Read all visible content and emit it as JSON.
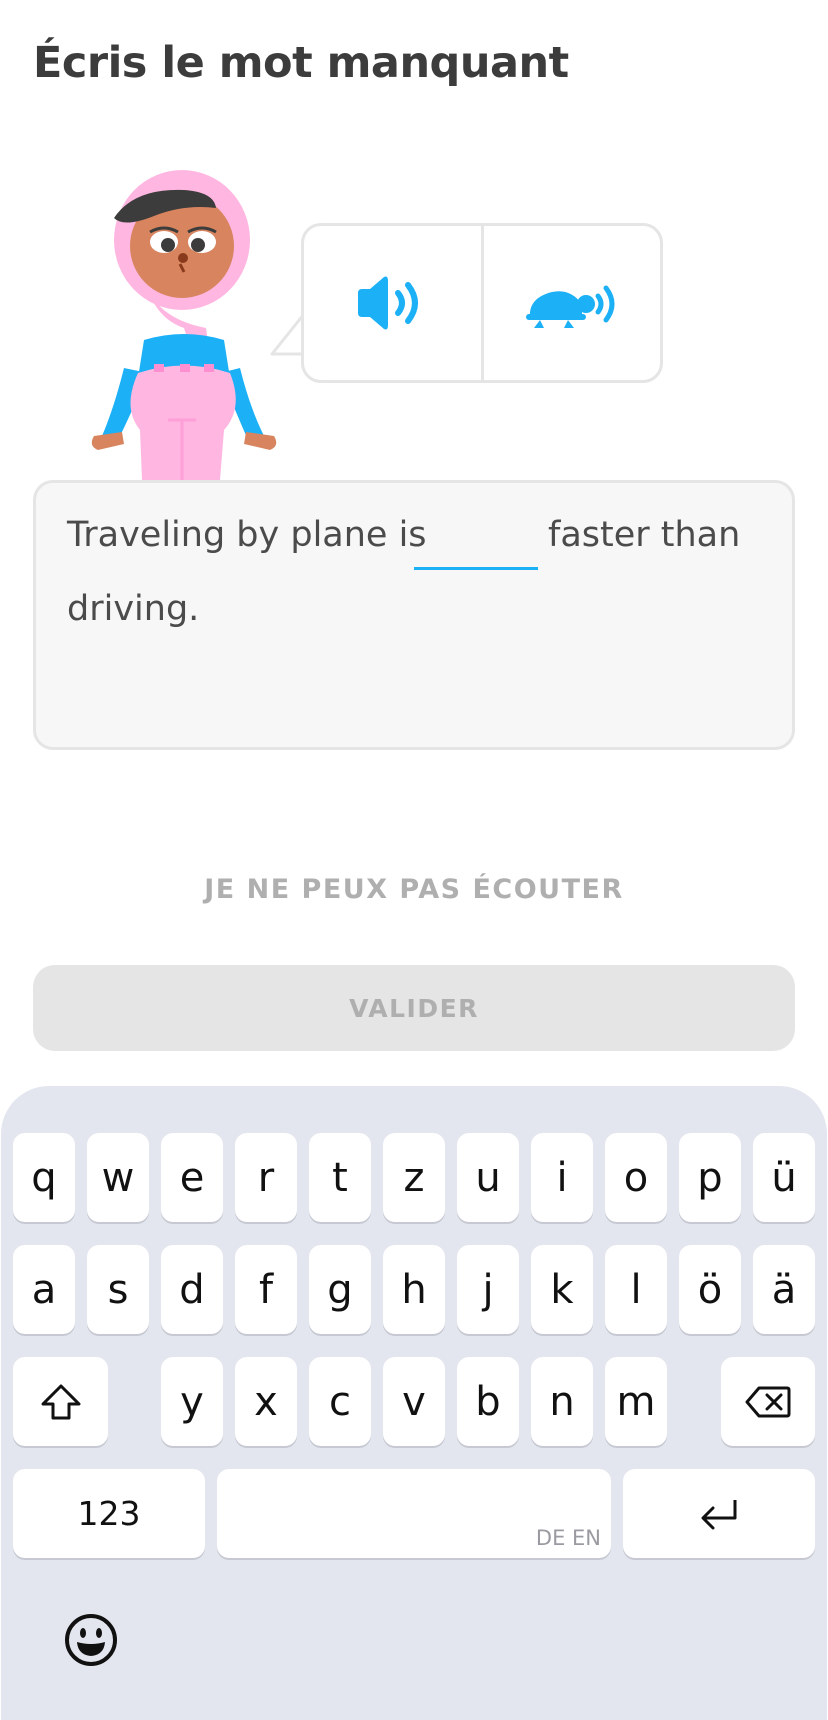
{
  "header": {
    "title": "Écris le mot manquant"
  },
  "audio": {
    "play_icon": "speaker-icon",
    "slow_icon": "turtle-speaker-icon"
  },
  "sentence": {
    "before": "Traveling by plane is",
    "answer_value": "",
    "after": "faster than",
    "line2": "driving."
  },
  "actions": {
    "cant_listen": "JE NE PEUX PAS ÉCOUTER",
    "validate": "VALIDER"
  },
  "keyboard": {
    "row1": [
      "q",
      "w",
      "e",
      "r",
      "t",
      "z",
      "u",
      "i",
      "o",
      "p",
      "ü"
    ],
    "row2": [
      "a",
      "s",
      "d",
      "f",
      "g",
      "h",
      "j",
      "k",
      "l",
      "ö",
      "ä"
    ],
    "row3": [
      "y",
      "x",
      "c",
      "v",
      "b",
      "n",
      "m"
    ],
    "numbers_label": "123",
    "language_hint": "DE EN",
    "shift_icon": "shift-icon",
    "backspace_icon": "backspace-icon",
    "return_icon": "return-icon",
    "emoji_icon": "emoji-icon"
  },
  "colors": {
    "accent_blue": "#1cb0f6",
    "border": "#e5e5e5",
    "box_bg": "#f7f7f7",
    "disabled_text": "#afafaf",
    "keyboard_bg": "#e3e6ef",
    "character_pink": "#ffb6e1",
    "character_blue": "#1cb0f6"
  }
}
